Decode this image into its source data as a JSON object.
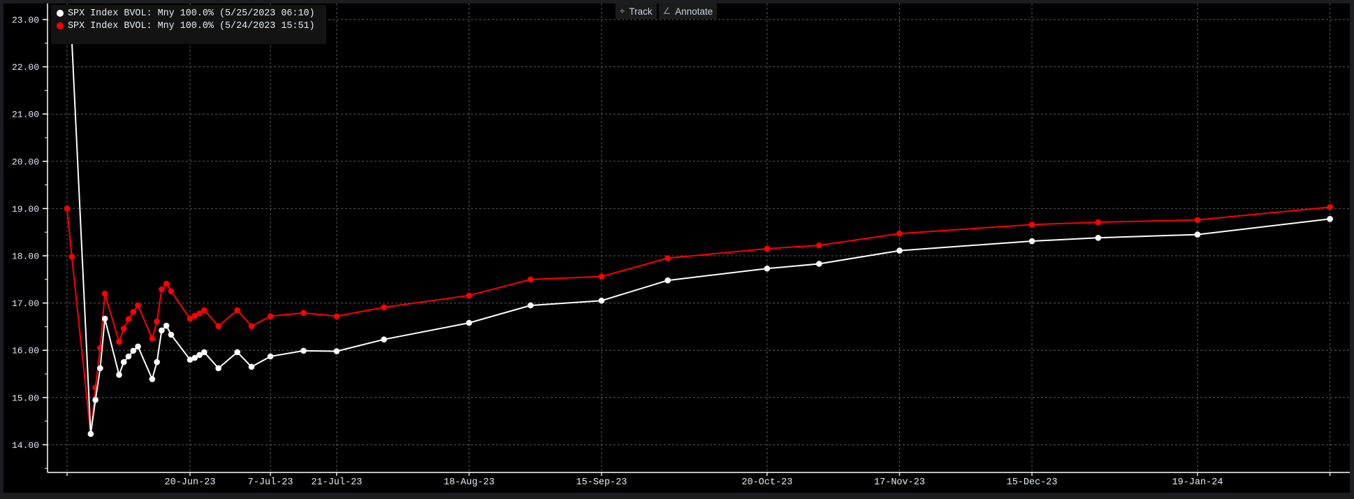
{
  "toolbar": {
    "track_label": "Track",
    "annotate_label": "Annotate",
    "track_icon": "crosshair-icon",
    "annotate_icon": "pencil-icon"
  },
  "legend": [
    {
      "label": "SPX Index BVOL: Mny 100.0% (5/25/2023 06:10)",
      "color": "#ffffff"
    },
    {
      "label": "SPX Index BVOL: Mny 100.0% (5/24/2023 15:51)",
      "color": "#ff0000"
    }
  ],
  "chart_data": {
    "type": "line",
    "title": "",
    "xlabel": "",
    "ylabel": "",
    "ylim": [
      13.4,
      23.35
    ],
    "xlim": [
      "2023-05-21",
      "2024-02-19"
    ],
    "grid": true,
    "legend_position": "top-left",
    "y_ticks": [
      "14.00",
      "15.00",
      "16.00",
      "17.00",
      "18.00",
      "19.00",
      "20.00",
      "21.00",
      "22.00",
      "23.00"
    ],
    "x_ticks": [
      {
        "date": "2023-05-25",
        "label": ""
      },
      {
        "date": "2023-06-20",
        "label": "20-Jun-23"
      },
      {
        "date": "2023-07-07",
        "label": "7-Jul-23"
      },
      {
        "date": "2023-07-21",
        "label": "21-Jul-23"
      },
      {
        "date": "2023-08-18",
        "label": "18-Aug-23"
      },
      {
        "date": "2023-09-15",
        "label": "15-Sep-23"
      },
      {
        "date": "2023-10-20",
        "label": "20-Oct-23"
      },
      {
        "date": "2023-11-17",
        "label": "17-Nov-23"
      },
      {
        "date": "2023-12-15",
        "label": "15-Dec-23"
      },
      {
        "date": "2024-01-19",
        "label": "19-Jan-24"
      },
      {
        "date": "2024-02-16",
        "label": ""
      }
    ],
    "series": [
      {
        "name": "SPX Index BVOL: Mny 100.0% (5/24/2023 15:51)",
        "color": "#ff0000",
        "points": [
          [
            "2023-05-25",
            19.0
          ],
          [
            "2023-05-26",
            17.98
          ],
          [
            "2023-05-30",
            14.23
          ],
          [
            "2023-05-31",
            15.21
          ],
          [
            "2023-06-01",
            16.05
          ],
          [
            "2023-06-02",
            17.2
          ],
          [
            "2023-06-05",
            16.18
          ],
          [
            "2023-06-06",
            16.46
          ],
          [
            "2023-06-07",
            16.66
          ],
          [
            "2023-06-08",
            16.81
          ],
          [
            "2023-06-09",
            16.95
          ],
          [
            "2023-06-12",
            16.25
          ],
          [
            "2023-06-13",
            16.61
          ],
          [
            "2023-06-14",
            17.29
          ],
          [
            "2023-06-15",
            17.41
          ],
          [
            "2023-06-16",
            17.25
          ],
          [
            "2023-06-20",
            16.67
          ],
          [
            "2023-06-21",
            16.73
          ],
          [
            "2023-06-22",
            16.78
          ],
          [
            "2023-06-23",
            16.85
          ],
          [
            "2023-06-26",
            16.51
          ],
          [
            "2023-06-30",
            16.85
          ],
          [
            "2023-07-03",
            16.51
          ],
          [
            "2023-07-07",
            16.72
          ],
          [
            "2023-07-14",
            16.79
          ],
          [
            "2023-07-21",
            16.72
          ],
          [
            "2023-07-31",
            16.91
          ],
          [
            "2023-08-18",
            17.16
          ],
          [
            "2023-08-31",
            17.5
          ],
          [
            "2023-09-15",
            17.56
          ],
          [
            "2023-09-29",
            17.95
          ],
          [
            "2023-10-20",
            18.15
          ],
          [
            "2023-10-31",
            18.22
          ],
          [
            "2023-11-17",
            18.47
          ],
          [
            "2023-12-15",
            18.66
          ],
          [
            "2023-12-29",
            18.71
          ],
          [
            "2024-01-19",
            18.76
          ],
          [
            "2024-02-16",
            19.03
          ]
        ]
      },
      {
        "name": "SPX Index BVOL: Mny 100.0% (5/25/2023 06:10)",
        "color": "#ffffff",
        "first_point_color": "#8a8a8a",
        "points": [
          [
            "2023-05-26",
            22.56
          ],
          [
            "2023-05-30",
            14.23
          ],
          [
            "2023-05-31",
            14.95
          ],
          [
            "2023-06-01",
            15.62
          ],
          [
            "2023-06-02",
            16.67
          ],
          [
            "2023-06-05",
            15.48
          ],
          [
            "2023-06-06",
            15.75
          ],
          [
            "2023-06-07",
            15.87
          ],
          [
            "2023-06-08",
            15.99
          ],
          [
            "2023-06-09",
            16.08
          ],
          [
            "2023-06-12",
            15.39
          ],
          [
            "2023-06-13",
            15.75
          ],
          [
            "2023-06-14",
            16.42
          ],
          [
            "2023-06-15",
            16.52
          ],
          [
            "2023-06-16",
            16.33
          ],
          [
            "2023-06-20",
            15.8
          ],
          [
            "2023-06-21",
            15.84
          ],
          [
            "2023-06-22",
            15.9
          ],
          [
            "2023-06-23",
            15.96
          ],
          [
            "2023-06-26",
            15.62
          ],
          [
            "2023-06-30",
            15.96
          ],
          [
            "2023-07-03",
            15.65
          ],
          [
            "2023-07-07",
            15.87
          ],
          [
            "2023-07-14",
            15.99
          ],
          [
            "2023-07-21",
            15.98
          ],
          [
            "2023-07-31",
            16.23
          ],
          [
            "2023-08-18",
            16.58
          ],
          [
            "2023-08-31",
            16.95
          ],
          [
            "2023-09-15",
            17.05
          ],
          [
            "2023-09-29",
            17.48
          ],
          [
            "2023-10-20",
            17.73
          ],
          [
            "2023-10-31",
            17.83
          ],
          [
            "2023-11-17",
            18.11
          ],
          [
            "2023-12-15",
            18.31
          ],
          [
            "2023-12-29",
            18.38
          ],
          [
            "2024-01-19",
            18.45
          ],
          [
            "2024-02-16",
            18.78
          ]
        ]
      }
    ]
  }
}
